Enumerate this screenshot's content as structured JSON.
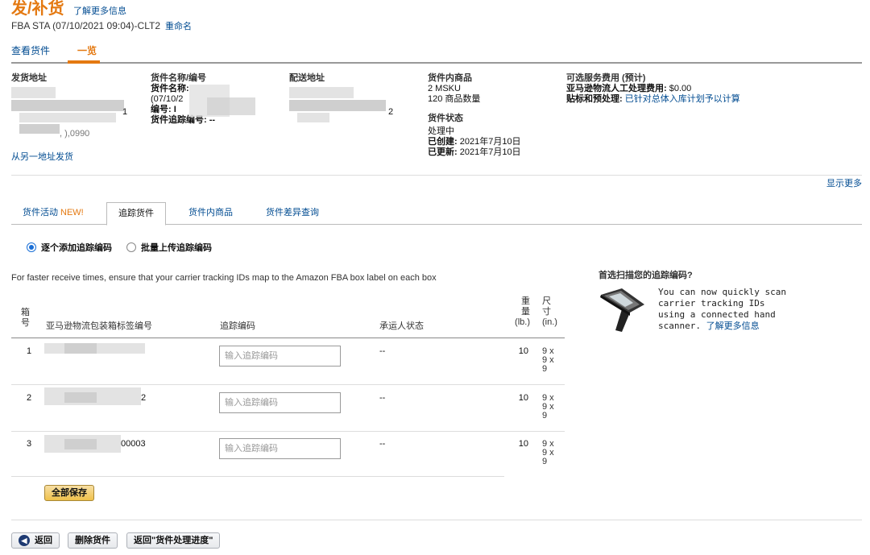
{
  "header": {
    "title": "发/补货",
    "learn_more": "了解更多信息",
    "subtitle": "FBA STA (07/10/2021 09:04)-CLT2",
    "rename": "重命名"
  },
  "top_tabs": {
    "view": "查看货件",
    "summary": "一览"
  },
  "ship_from": {
    "label": "发货地址",
    "frag1": "1",
    "frag2": ", ),0990",
    "link": "从另一地址发货"
  },
  "shipment_name": {
    "label": "货件名称/编号",
    "name_label": "货件名称:",
    "name_value": "(07/10/2",
    "id_label": "编号: I",
    "tracking_label": "货件追踪编号: --"
  },
  "ship_to": {
    "label": "配送地址",
    "frag": "2"
  },
  "contents": {
    "label": "货件内商品",
    "msku": "2 MSKU",
    "units": "120 商品数量",
    "status_label": "货件状态",
    "status": "处理中",
    "created_label": "已创建:",
    "created": "2021年7月10日",
    "updated_label": "已更新:",
    "updated": "2021年7月10日"
  },
  "fees": {
    "label": "可选服务费用 (预计)",
    "labor_label": "亚马逊物流人工处理费用:",
    "labor_value": "$0.00",
    "prep_label": "贴标和预处理:",
    "prep_link": "已针对总体入库计划予以计算"
  },
  "show_more": "显示更多",
  "sub_tabs": {
    "activity": "货件活动",
    "activity_badge": "NEW!",
    "track": "追踪货件",
    "contents": "货件内商品",
    "discrepancy": "货件差异查询"
  },
  "radios": {
    "one_by_one": "逐个添加追踪编码",
    "bulk": "批量上传追踪编码"
  },
  "hint": "For faster receive times, ensure that your carrier tracking IDs map to the Amazon FBA box label on each box",
  "table": {
    "headers": {
      "box_no_1": "箱",
      "box_no_2": "号",
      "label_id": "亚马逊物流包装箱标签编号",
      "tracking": "追踪编码",
      "carrier_status": "承运人状态",
      "weight_1": "重",
      "weight_2": "量",
      "weight_3": "(lb.)",
      "dims_1": "尺",
      "dims_2": "寸",
      "dims_3": "(in.)"
    },
    "rows": [
      {
        "no": "1",
        "label_frag": "",
        "placeholder": "输入追踪编码",
        "status": "--",
        "weight": "10",
        "dims": [
          "9 x",
          "9 x",
          "9"
        ]
      },
      {
        "no": "2",
        "label_frag": "2",
        "placeholder": "输入追踪编码",
        "status": "--",
        "weight": "10",
        "dims": [
          "9 x",
          "9 x",
          "9"
        ]
      },
      {
        "no": "3",
        "label_frag": "00003",
        "placeholder": "输入追踪编码",
        "status": "--",
        "weight": "10",
        "dims": [
          "9 x",
          "9 x",
          "9"
        ]
      }
    ]
  },
  "save_all": "全部保存",
  "nav": {
    "back": "返回",
    "delete": "删除货件",
    "return_progress": "返回\"货件处理进度\""
  },
  "scanner_panel": {
    "title": "首选扫描您的追踪编码?",
    "text": "You can now quickly scan carrier tracking IDs using a connected hand scanner.",
    "link": "了解更多信息"
  },
  "colors": {
    "accent": "#e47911",
    "link": "#004b91",
    "button_yellow": "#f0c14b"
  },
  "icons": {
    "back": "back-arrow-icon",
    "scanner": "hand-scanner-icon"
  }
}
